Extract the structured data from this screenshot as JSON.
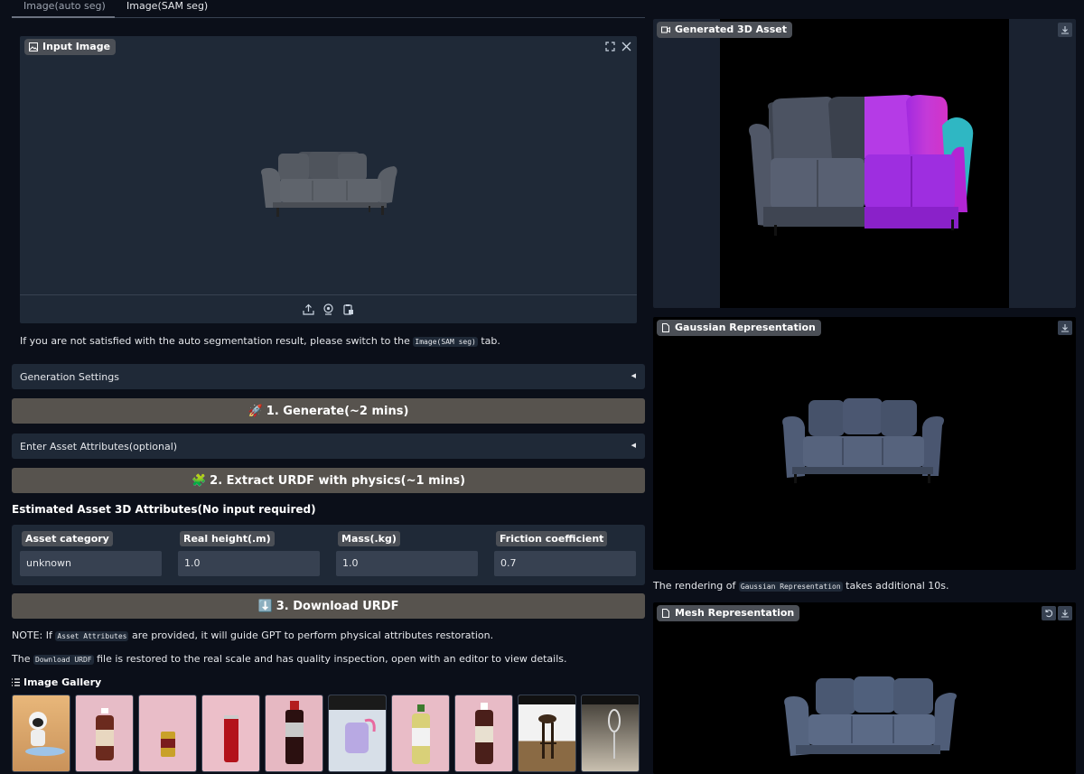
{
  "tabs": [
    "Image(auto seg)",
    "Image(SAM seg)"
  ],
  "input_image": {
    "label": "Input Image"
  },
  "seg_note": {
    "before": "If you are not satisfied with the auto segmentation result, please switch to the",
    "code": "Image(SAM seg)",
    "after": "tab."
  },
  "generation_settings": "Generation Settings",
  "generate_button": {
    "emoji": "🚀",
    "label": "1. Generate(~2 mins)"
  },
  "asset_attributes": "Enter Asset Attributes(optional)",
  "extract_button": {
    "emoji": "🧩",
    "label": "2. Extract URDF with physics(~1 mins)"
  },
  "estimated_title": "Estimated Asset 3D Attributes(No input required)",
  "attributes": [
    {
      "label": "Asset category",
      "value": "unknown"
    },
    {
      "label": "Real height(.m)",
      "value": "1.0"
    },
    {
      "label": "Mass(.kg)",
      "value": "1.0"
    },
    {
      "label": "Friction coefficient",
      "value": "0.7"
    }
  ],
  "download_button": {
    "emoji": "⬇️",
    "label": "3. Download URDF"
  },
  "note_attrs": {
    "before": "NOTE: If",
    "code": "Asset Attributes",
    "after": "are provided, it will guide GPT to perform physical attributes restoration."
  },
  "note_download": {
    "before": "The",
    "code": "Download URDF",
    "after": "file is restored to the real scale and has quality inspection, open with an editor to view details."
  },
  "gallery": {
    "title": "Image Gallery",
    "count": 10
  },
  "generated_3d": {
    "label": "Generated 3D Asset"
  },
  "gaussian": {
    "label": "Gaussian Representation"
  },
  "gaussian_note": {
    "before": "The rendering of",
    "code": "Gaussian Representation",
    "after": "takes additional 10s."
  },
  "mesh": {
    "label": "Mesh Representation"
  },
  "colors": {
    "bg": "#0b0f19",
    "panel": "#1f2937",
    "button": "#57534e",
    "chip": "#4b4f56"
  }
}
